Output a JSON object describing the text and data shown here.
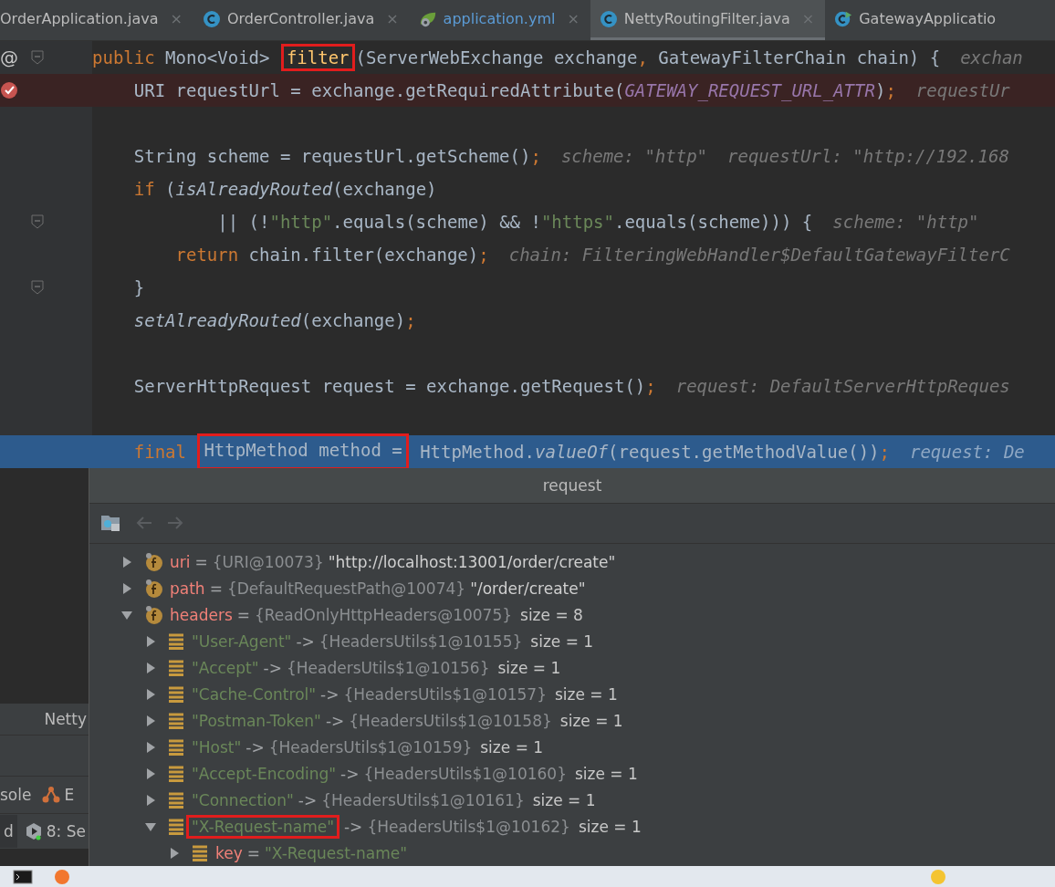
{
  "tabs": [
    {
      "label": "OrderApplication.java",
      "color": "#bbbbbb",
      "selected": false,
      "close": "×"
    },
    {
      "label": "OrderController.java",
      "kind": "class",
      "color": "#bbbbbb",
      "selected": false,
      "close": "×"
    },
    {
      "label": "application.yml",
      "kind": "config",
      "color": "#5b9bd5",
      "selected": false,
      "close": "×"
    },
    {
      "label": "NettyRoutingFilter.java",
      "kind": "class",
      "color": "#bbbbbb",
      "selected": true,
      "close": "×"
    },
    {
      "label": "GatewayApplicatio",
      "kind": "run-class",
      "color": "#bbbbbb",
      "selected": false
    }
  ],
  "editor": {
    "lines": [
      {
        "breakpoint": false,
        "current": false,
        "gutter_text": "@",
        "fold": true,
        "tokens": [
          {
            "kind": "kw",
            "text": "public"
          },
          {
            "kind": "plain",
            "text": " Mono<Void> "
          },
          {
            "kind": "decl",
            "text": "filter",
            "boxed": true
          },
          {
            "kind": "plain",
            "text": "(ServerWebExchange exchange"
          },
          {
            "kind": "punct",
            "text": ","
          },
          {
            "kind": "plain",
            "text": " GatewayFilterChain chain) {"
          }
        ],
        "hints": [
          "exchan"
        ]
      },
      {
        "breakpoint": true,
        "current": false,
        "fold": false,
        "tokens": [
          {
            "kind": "plain",
            "text": "    URI requestUrl = exchange.getRequiredAttribute("
          },
          {
            "kind": "const",
            "text": "GATEWAY_REQUEST_URL_ATTR"
          },
          {
            "kind": "plain",
            "text": ")"
          },
          {
            "kind": "punct",
            "text": ";"
          }
        ],
        "hints": [
          "requestUr"
        ]
      },
      {
        "breakpoint": false,
        "current": false,
        "fold": false
      },
      {
        "breakpoint": false,
        "current": false,
        "fold": false,
        "tokens": [
          {
            "kind": "plain",
            "text": "    String scheme = requestUrl.getScheme()"
          },
          {
            "kind": "punct",
            "text": ";"
          }
        ],
        "hints": [
          "scheme: \"http\"",
          "requestUrl: \"http://192.168"
        ]
      },
      {
        "breakpoint": false,
        "current": false,
        "fold": false,
        "tokens": [
          {
            "kind": "kw",
            "text": "    if"
          },
          {
            "kind": "plain",
            "text": " ("
          },
          {
            "kind": "ital",
            "text": "isAlreadyRouted"
          },
          {
            "kind": "plain",
            "text": "(exchange)"
          }
        ]
      },
      {
        "breakpoint": false,
        "current": false,
        "fold": true,
        "tokens": [
          {
            "kind": "plain",
            "text": "            || (!"
          },
          {
            "kind": "str",
            "text": "\"http\""
          },
          {
            "kind": "plain",
            "text": ".equals(scheme) && !"
          },
          {
            "kind": "str",
            "text": "\"https\""
          },
          {
            "kind": "plain",
            "text": ".equals(scheme))) {"
          }
        ],
        "hints": [
          "scheme: \"http\""
        ]
      },
      {
        "breakpoint": false,
        "current": false,
        "fold": false,
        "tokens": [
          {
            "kind": "kw",
            "text": "        return"
          },
          {
            "kind": "plain",
            "text": " chain.filter(exchange)"
          },
          {
            "kind": "punct",
            "text": ";"
          }
        ],
        "hints": [
          "chain: FilteringWebHandler$DefaultGatewayFilterC"
        ]
      },
      {
        "breakpoint": false,
        "current": false,
        "fold": true,
        "tokens": [
          {
            "kind": "plain",
            "text": "    }"
          }
        ]
      },
      {
        "breakpoint": false,
        "current": false,
        "fold": false,
        "tokens": [
          {
            "kind": "ital",
            "text": "    setAlreadyRouted"
          },
          {
            "kind": "plain",
            "text": "(exchange)"
          },
          {
            "kind": "punct",
            "text": ";"
          }
        ]
      },
      {
        "breakpoint": false,
        "current": false,
        "fold": false
      },
      {
        "breakpoint": false,
        "current": false,
        "fold": false,
        "tokens": [
          {
            "kind": "plain",
            "text": "    ServerHttpRequest request = exchange.getRequest()"
          },
          {
            "kind": "punct",
            "text": ";"
          }
        ],
        "hints": [
          "request: DefaultServerHttpReques"
        ]
      },
      {
        "breakpoint": false,
        "current": false,
        "fold": false
      },
      {
        "breakpoint": false,
        "current": true,
        "fold": false,
        "tokens": [
          {
            "kind": "kw",
            "text": "    final "
          },
          {
            "kind": "plain",
            "text": "HttpMethod method =",
            "boxed": true
          },
          {
            "kind": "plain",
            "text": " HttpMethod."
          },
          {
            "kind": "ital",
            "text": "valueOf"
          },
          {
            "kind": "plain",
            "text": "(request.getMethodValue())"
          },
          {
            "kind": "punct",
            "text": ";"
          }
        ],
        "hints": [
          "request: De"
        ]
      }
    ]
  },
  "side_panel": {
    "tab": "Netty",
    "tool_items": [
      {
        "label": "sole"
      },
      {
        "label": "E",
        "kind": "branch"
      }
    ],
    "run_items": [
      {
        "label": "d"
      },
      {
        "label": "8: Se",
        "kind": "play"
      }
    ]
  },
  "popup": {
    "title": "request",
    "tree": [
      {
        "kind": "field",
        "name": "uri",
        "sep": "=",
        "type": "{URI@10073}",
        "value": "\"http://localhost:13001/order/create\"",
        "expanded": false
      },
      {
        "kind": "field",
        "name": "path",
        "sep": "=",
        "type": "{DefaultRequestPath@10074}",
        "value": "\"/order/create\"",
        "expanded": false
      },
      {
        "kind": "field",
        "name": "headers",
        "sep": "=",
        "type": "{ReadOnlyHttpHeaders@10075}",
        "size": "size = 8",
        "expanded": true,
        "children": [
          {
            "kind": "entry",
            "name": "\"User-Agent\"",
            "sep": "->",
            "type": "{HeadersUtils$1@10155}",
            "size": "size = 1",
            "expanded": false
          },
          {
            "kind": "entry",
            "name": "\"Accept\"",
            "sep": "->",
            "type": "{HeadersUtils$1@10156}",
            "size": "size = 1",
            "expanded": false
          },
          {
            "kind": "entry",
            "name": "\"Cache-Control\"",
            "sep": "->",
            "type": "{HeadersUtils$1@10157}",
            "size": "size = 1",
            "expanded": false
          },
          {
            "kind": "entry",
            "name": "\"Postman-Token\"",
            "sep": "->",
            "type": "{HeadersUtils$1@10158}",
            "size": "size = 1",
            "expanded": false
          },
          {
            "kind": "entry",
            "name": "\"Host\"",
            "sep": "->",
            "type": "{HeadersUtils$1@10159}",
            "size": "size = 1",
            "expanded": false
          },
          {
            "kind": "entry",
            "name": "\"Accept-Encoding\"",
            "sep": "->",
            "type": "{HeadersUtils$1@10160}",
            "size": "size = 1",
            "expanded": false
          },
          {
            "kind": "entry",
            "name": "\"Connection\"",
            "sep": "->",
            "type": "{HeadersUtils$1@10161}",
            "size": "size = 1",
            "expanded": false
          },
          {
            "kind": "entry",
            "name": "\"X-Request-name\"",
            "sep": "->",
            "type": "{HeadersUtils$1@10162}",
            "size": "size = 1",
            "expanded": true,
            "boxed": true,
            "children": [
              {
                "kind": "field-entry",
                "name": "key",
                "sep": "=",
                "value": "\"X-Request-name\"",
                "expanded": false
              }
            ]
          }
        ]
      }
    ]
  }
}
